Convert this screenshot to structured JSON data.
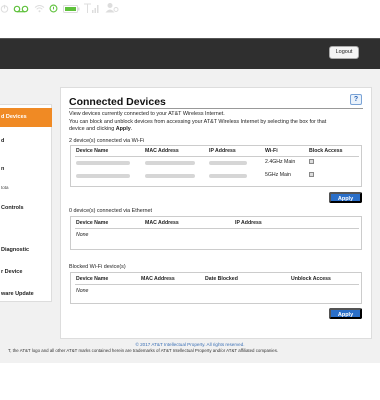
{
  "header": {
    "logout_label": "Logout"
  },
  "icons": [
    "power-icon",
    "voicemail-icon",
    "wifi-icon",
    "status-icon",
    "battery-icon",
    "signal-icon",
    "user-settings-icon"
  ],
  "sidebar": {
    "items": [
      {
        "label": "d Devices"
      },
      {
        "label": "d"
      },
      {
        "label": "n"
      },
      {
        "label": "Controls"
      },
      {
        "label": "Diagnostic"
      },
      {
        "label": "r Device"
      },
      {
        "label": "ware Update"
      }
    ],
    "sub_label": "tota"
  },
  "main": {
    "title": "Connected Devices",
    "help": "?",
    "description_1": "View devices currently connected to your AT&T Wireless Internet.",
    "description_2": "You can block and unblock devices from accessing your AT&T Wireless Internet by selecting the box for that",
    "description_3_prefix": "device and clicking",
    "description_3_bold": "Apply",
    "description_3_suffix": "."
  },
  "wifi_section": {
    "label": "2 device(s) connected via Wi-Fi",
    "headers": [
      "Device Name",
      "MAC Address",
      "IP Address",
      "Wi-Fi",
      "Block Access"
    ],
    "rows": [
      {
        "band": "2.4GHz Main"
      },
      {
        "band": "5GHz Main"
      }
    ],
    "apply_label": "Apply"
  },
  "ethernet_section": {
    "label": "0 device(s) connected via Ethernet",
    "headers": [
      "Device Name",
      "MAC Address",
      "IP Address"
    ],
    "empty": "None"
  },
  "blocked_section": {
    "label": "Blocked Wi-Fi device(s)",
    "headers": [
      "Device Name",
      "MAC Address",
      "Date Blocked",
      "Unblock Access"
    ],
    "empty": "None",
    "apply_label": "Apply"
  },
  "footer": {
    "copyright": "© 2017 AT&T Intellectual Property. All rights reserved.",
    "trademark": "T, the AT&T logo and all other AT&T marks contained herein are trademarks of AT&T Intellectual Property and/or AT&T affiliated companies."
  },
  "colors": {
    "accent_orange": "#f08a24",
    "button_blue": "#2a6fc9",
    "topbar": "#2f2f2f"
  }
}
